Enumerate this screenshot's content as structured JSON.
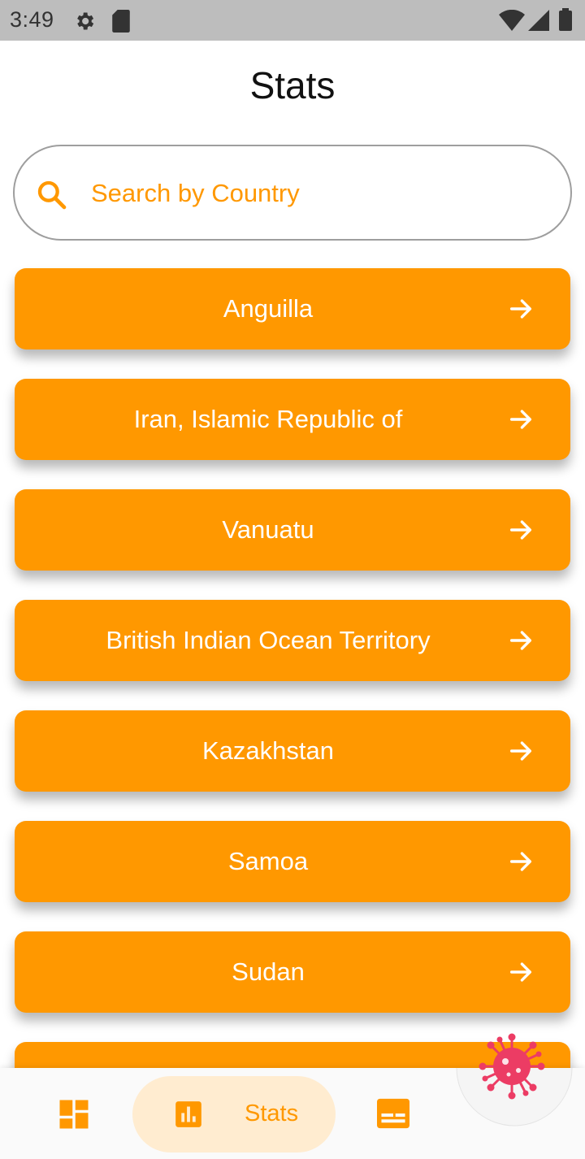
{
  "status_bar": {
    "time": "3:49",
    "icons": [
      "gear-icon",
      "sd-card-icon",
      "wifi-icon",
      "signal-icon",
      "battery-icon"
    ]
  },
  "page": {
    "title": "Stats"
  },
  "search": {
    "placeholder": "Search by Country",
    "value": "",
    "icon": "search-icon"
  },
  "countries": [
    {
      "name": "Anguilla"
    },
    {
      "name": "Iran, Islamic Republic of"
    },
    {
      "name": "Vanuatu"
    },
    {
      "name": "British Indian Ocean Territory"
    },
    {
      "name": "Kazakhstan"
    },
    {
      "name": "Samoa"
    },
    {
      "name": "Sudan"
    }
  ],
  "bottom_nav": {
    "items": [
      {
        "icon": "dashboard-icon",
        "label": ""
      },
      {
        "icon": "bar-chart-icon",
        "label": "Stats",
        "selected": true
      },
      {
        "icon": "news-icon",
        "label": ""
      }
    ]
  },
  "fab": {
    "icon": "virus-icon"
  },
  "colors": {
    "accent": "#ff9800",
    "accent_light": "#ffecd0",
    "virus": "#ec3c64",
    "status_bar": "#bdbdbd"
  }
}
